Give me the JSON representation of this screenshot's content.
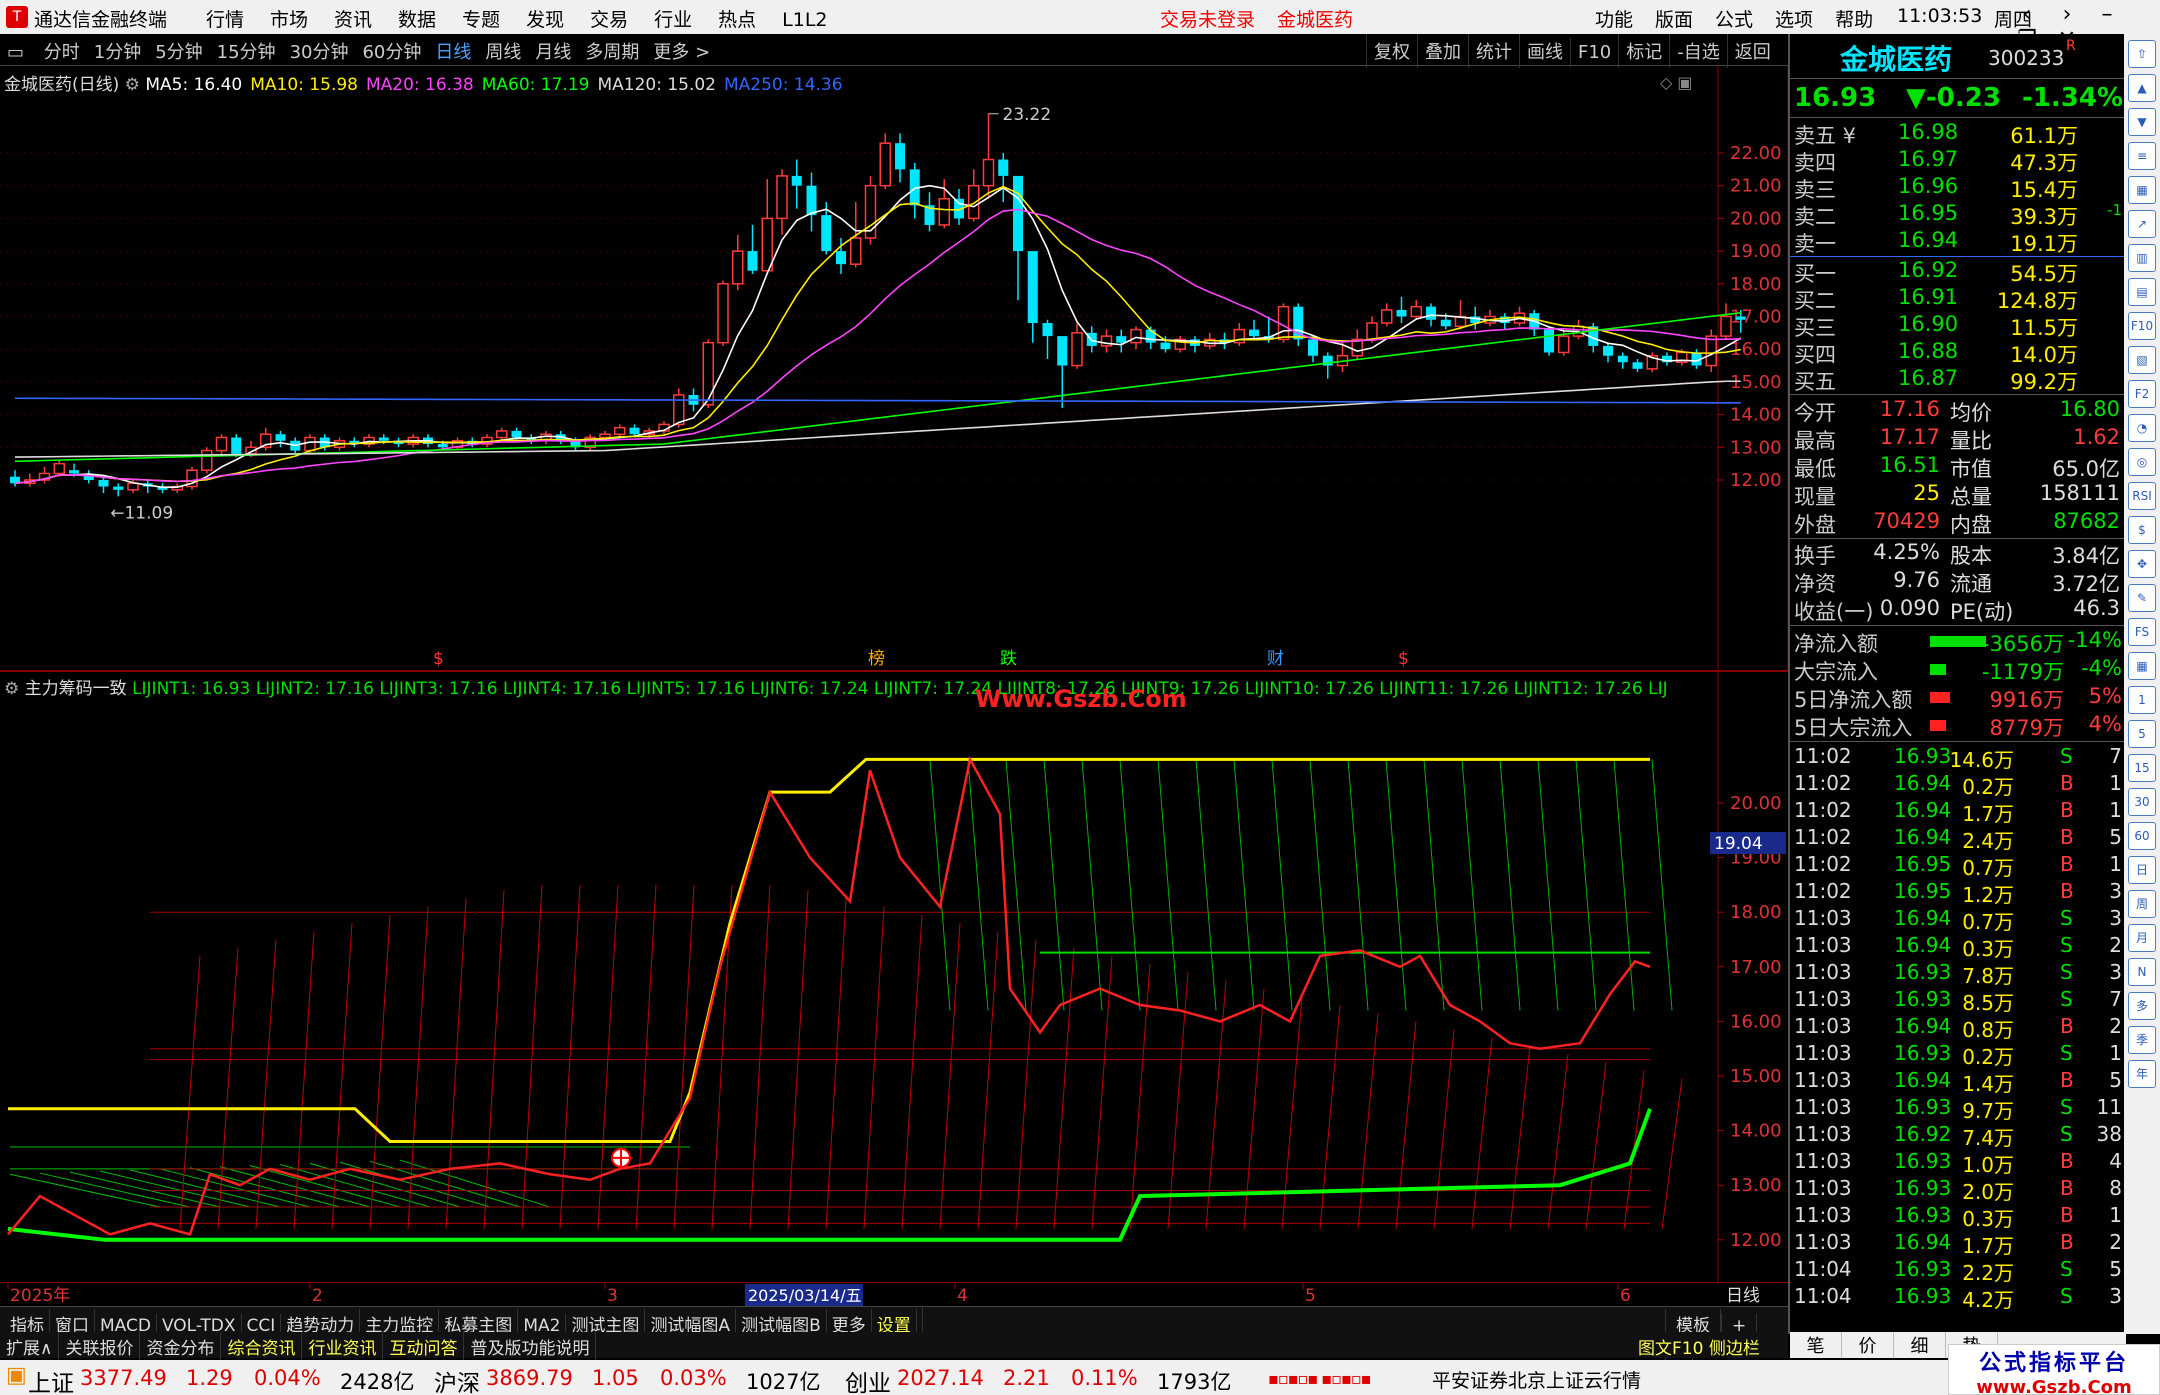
{
  "titlebar": {
    "app_name": "通达信金融终端",
    "menu": [
      "行情",
      "市场",
      "资讯",
      "数据",
      "专题",
      "发现",
      "交易",
      "行业",
      "热点",
      "L1L2"
    ],
    "warn": [
      "交易未登录",
      "金城医药"
    ],
    "right_menu": [
      "功能",
      "版面",
      "公式",
      "选项",
      "帮助"
    ],
    "time": "11:03:53",
    "weekday": "周四"
  },
  "period_toolbar": {
    "items": [
      "分时",
      "1分钟",
      "5分钟",
      "15分钟",
      "30分钟",
      "60分钟",
      "日线",
      "周线",
      "月线",
      "多周期",
      "更多 >"
    ],
    "active": "日线",
    "right_items": [
      "复权",
      "叠加",
      "统计",
      "画线",
      "F10",
      "标记",
      "-自选",
      "返回"
    ]
  },
  "main_chart": {
    "title": "金城医药(日线)",
    "ma_labels": [
      {
        "text": "MA5: 16.40",
        "color": "#ffffff"
      },
      {
        "text": "MA10: 15.98",
        "color": "#ffee00"
      },
      {
        "text": "MA20: 16.38",
        "color": "#ff44ff"
      },
      {
        "text": "MA60: 17.19",
        "color": "#00ff00"
      },
      {
        "text": "MA120: 15.02",
        "color": "#dddddd"
      },
      {
        "text": "MA250: 14.36",
        "color": "#3366ff"
      }
    ],
    "price_axis": [
      "22.00",
      "21.00",
      "20.00",
      "19.00",
      "18.00",
      "17.00",
      "16.00",
      "15.00",
      "14.00",
      "13.00",
      "12.00"
    ],
    "high_label": "23.22",
    "low_label": "11.09",
    "event_marks": [
      {
        "text": "$",
        "color": "#ff3333"
      },
      {
        "text": "榜",
        "color": "#ffaa00"
      },
      {
        "text": "跌",
        "color": "#00ff00"
      },
      {
        "text": "财",
        "color": "#3399ff"
      },
      {
        "text": "$",
        "color": "#ff3333"
      }
    ]
  },
  "sub_chart": {
    "title": "主力筹码一致",
    "labels": "LIJINT1: 16.93  LIJINT2: 17.16  LIJINT3: 17.16  LIJINT4: 17.16  LIJINT5: 17.16  LIJINT6: 17.24  LIJINT7: 17.24  LIJINT8: 17.26  LIJINT9: 17.26  LIJINT10: 17.26  LIJINT11: 17.26  LIJINT12: 17.26  LIJ",
    "watermark": "Www.Gszb.Com",
    "price_axis": [
      "20.00",
      "19.00",
      "18.00",
      "17.00",
      "16.00",
      "15.00",
      "14.00",
      "13.00",
      "12.00"
    ],
    "cursor_price": "19.04"
  },
  "date_axis": {
    "labels": [
      "2025年",
      "2",
      "3",
      "4",
      "5",
      "6"
    ],
    "cursor_date": "2025/03/14/五",
    "mode": "日线"
  },
  "bottom_tabs": {
    "row1": [
      "指标",
      "窗口",
      "MACD",
      "VOL-TDX",
      "CCI",
      "趋势动力",
      "主力监控",
      "私募主图",
      "MA2",
      "测试主图",
      "测试幅图A",
      "测试幅图B",
      "更多",
      "设置"
    ],
    "row1_right": [
      "模板",
      "+",
      "-"
    ],
    "row2": [
      "扩展∧",
      "关联报价",
      "资金分布",
      "综合资讯",
      "行业资讯",
      "互动问答",
      "普及版功能说明"
    ],
    "row2_right": "图文F10  侧边栏 《"
  },
  "quote": {
    "name": "金城医药",
    "code": "300233",
    "tag": "R",
    "price": "16.93",
    "change": "▼-0.23",
    "pct": "-1.34%",
    "asks": [
      {
        "label": "卖五 ¥",
        "price": "16.98",
        "vol": "61.1万",
        "chg": ""
      },
      {
        "label": "卖四",
        "price": "16.97",
        "vol": "47.3万",
        "chg": ""
      },
      {
        "label": "卖三",
        "price": "16.96",
        "vol": "15.4万",
        "chg": ""
      },
      {
        "label": "卖二",
        "price": "16.95",
        "vol": "39.3万",
        "chg": "-1"
      },
      {
        "label": "卖一",
        "price": "16.94",
        "vol": "19.1万",
        "chg": ""
      }
    ],
    "bids": [
      {
        "label": "买一",
        "price": "16.92",
        "vol": "54.5万"
      },
      {
        "label": "买二",
        "price": "16.91",
        "vol": "124.8万"
      },
      {
        "label": "买三",
        "price": "16.90",
        "vol": "11.5万"
      },
      {
        "label": "买四",
        "price": "16.88",
        "vol": "14.0万"
      },
      {
        "label": "买五",
        "price": "16.87",
        "vol": "99.2万"
      }
    ],
    "stats": [
      {
        "l1": "今开",
        "v1": "17.16",
        "c1": "red",
        "l2": "均价",
        "v2": "16.80",
        "c2": "green"
      },
      {
        "l1": "最高",
        "v1": "17.17",
        "c1": "red",
        "l2": "量比",
        "v2": "1.62",
        "c2": "red"
      },
      {
        "l1": "最低",
        "v1": "16.51",
        "c1": "green",
        "l2": "市值",
        "v2": "65.0亿",
        "c2": "white"
      },
      {
        "l1": "现量",
        "v1": "25",
        "c1": "yellow",
        "l2": "总量",
        "v2": "158111",
        "c2": "white"
      },
      {
        "l1": "外盘",
        "v1": "70429",
        "c1": "red",
        "l2": "内盘",
        "v2": "87682",
        "c2": "green"
      },
      {
        "l1": "换手",
        "v1": "4.25%",
        "c1": "white",
        "l2": "股本",
        "v2": "3.84亿",
        "c2": "white"
      },
      {
        "l1": "净资",
        "v1": "9.76",
        "c1": "white",
        "l2": "流通",
        "v2": "3.72亿",
        "c2": "white"
      },
      {
        "l1": "收益(一)",
        "v1": "0.090",
        "c1": "white",
        "l2": "PE(动)",
        "v2": "46.3",
        "c2": "white"
      }
    ],
    "flows": [
      {
        "label": "净流入额",
        "value": "-3656万",
        "pct": "-14%",
        "color": "green",
        "bar": 0.14
      },
      {
        "label": "大宗流入",
        "value": "-1179万",
        "pct": "-4%",
        "color": "green",
        "bar": 0.04
      },
      {
        "label": "5日净流入额",
        "value": "9916万",
        "pct": "5%",
        "color": "red",
        "bar": 0.05
      },
      {
        "label": "5日大宗流入",
        "value": "8779万",
        "pct": "4%",
        "color": "red",
        "bar": 0.04
      }
    ],
    "ticks": [
      [
        "11:02",
        "16.93",
        "14.6万",
        "S",
        "7"
      ],
      [
        "11:02",
        "16.94",
        "0.2万",
        "B",
        "1"
      ],
      [
        "11:02",
        "16.94",
        "1.7万",
        "B",
        "1"
      ],
      [
        "11:02",
        "16.94",
        "2.4万",
        "B",
        "5"
      ],
      [
        "11:02",
        "16.95",
        "0.7万",
        "B",
        "1"
      ],
      [
        "11:02",
        "16.95",
        "1.2万",
        "B",
        "3"
      ],
      [
        "11:03",
        "16.94",
        "0.7万",
        "S",
        "3"
      ],
      [
        "11:03",
        "16.94",
        "0.3万",
        "S",
        "2"
      ],
      [
        "11:03",
        "16.93",
        "7.8万",
        "S",
        "3"
      ],
      [
        "11:03",
        "16.93",
        "8.5万",
        "S",
        "7"
      ],
      [
        "11:03",
        "16.94",
        "0.8万",
        "B",
        "2"
      ],
      [
        "11:03",
        "16.93",
        "0.2万",
        "S",
        "1"
      ],
      [
        "11:03",
        "16.94",
        "1.4万",
        "B",
        "5"
      ],
      [
        "11:03",
        "16.93",
        "9.7万",
        "S",
        "11"
      ],
      [
        "11:03",
        "16.92",
        "7.4万",
        "S",
        "38"
      ],
      [
        "11:03",
        "16.93",
        "1.0万",
        "B",
        "4"
      ],
      [
        "11:03",
        "16.93",
        "2.0万",
        "B",
        "8"
      ],
      [
        "11:03",
        "16.93",
        "0.3万",
        "B",
        "1"
      ],
      [
        "11:03",
        "16.94",
        "1.7万",
        "B",
        "2"
      ],
      [
        "11:04",
        "16.93",
        "2.2万",
        "S",
        "5"
      ],
      [
        "11:04",
        "16.93",
        "4.2万",
        "S",
        "3"
      ]
    ],
    "tabs": [
      "笔",
      "价",
      "细",
      "势"
    ]
  },
  "right_icons": [
    "⇧",
    "▲",
    "▼",
    "≡",
    "▦",
    "↗",
    "▥",
    "▤",
    "F10",
    "▧",
    "F2",
    "◔",
    "◎",
    "RSI",
    "$",
    "✥",
    "✎",
    "FS",
    "▦",
    "1",
    "5",
    "15",
    "30",
    "60",
    "日",
    "周",
    "月",
    "N",
    "多",
    "季",
    "年"
  ],
  "status": {
    "indices": [
      {
        "name": "上证",
        "value": "3377.49",
        "chg": "1.29",
        "pct": "0.04%",
        "amt": "2428亿"
      },
      {
        "name": "沪深",
        "value": "3869.79",
        "chg": "1.05",
        "pct": "0.03%",
        "amt": "1027亿"
      },
      {
        "name": "创业",
        "value": "2027.14",
        "chg": "2.21",
        "pct": "0.11%",
        "amt": "1793亿"
      }
    ],
    "server": "平安证券北京上证云行情",
    "brand": "公式指标平台",
    "brand_url": "www.Gszb.Com"
  }
}
